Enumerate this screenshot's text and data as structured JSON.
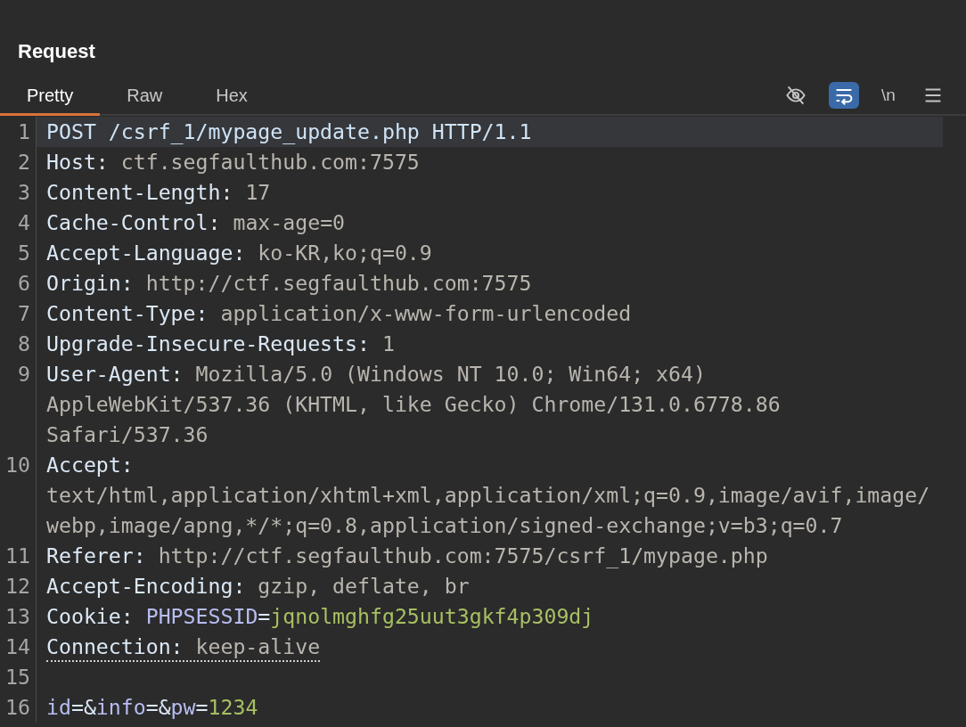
{
  "panel": {
    "title": "Request"
  },
  "tabs": [
    {
      "label": "Pretty",
      "selected": true
    },
    {
      "label": "Raw",
      "selected": false
    },
    {
      "label": "Hex",
      "selected": false
    }
  ],
  "toolbar": [
    {
      "kind": "eye_off",
      "selected": false
    },
    {
      "kind": "wrap",
      "selected": true
    },
    {
      "kind": "text",
      "label": "\\n",
      "selected": false
    },
    {
      "kind": "menu",
      "selected": false
    }
  ],
  "lines": [
    {
      "number": "1",
      "highlighted": true,
      "underlined": false,
      "segments": [
        {
          "kind": "request",
          "text": "POST /csrf_1/mypage_update.php HTTP/1.1"
        }
      ]
    },
    {
      "number": "2",
      "highlighted": false,
      "underlined": false,
      "segments": [
        {
          "kind": "header_name",
          "text": "Host:"
        },
        {
          "kind": "header_value",
          "text": "ctf.segfaulthub.com:7575"
        }
      ]
    },
    {
      "number": "3",
      "highlighted": false,
      "underlined": false,
      "segments": [
        {
          "kind": "header_name",
          "text": "Content-Length:"
        },
        {
          "kind": "header_value",
          "text": "17"
        }
      ]
    },
    {
      "number": "4",
      "highlighted": false,
      "underlined": false,
      "segments": [
        {
          "kind": "header_name",
          "text": "Cache-Control:"
        },
        {
          "kind": "header_value",
          "text": "max-age=0"
        }
      ]
    },
    {
      "number": "5",
      "highlighted": false,
      "underlined": false,
      "segments": [
        {
          "kind": "header_name",
          "text": "Accept-Language:"
        },
        {
          "kind": "header_value",
          "text": "ko-KR,ko;q=0.9"
        }
      ]
    },
    {
      "number": "6",
      "highlighted": false,
      "underlined": false,
      "segments": [
        {
          "kind": "header_name",
          "text": "Origin:"
        },
        {
          "kind": "header_value",
          "text": "http://ctf.segfaulthub.com:7575"
        }
      ]
    },
    {
      "number": "7",
      "highlighted": false,
      "underlined": false,
      "segments": [
        {
          "kind": "header_name",
          "text": "Content-Type:"
        },
        {
          "kind": "header_value",
          "text": "application/x-www-form-urlencoded"
        }
      ]
    },
    {
      "number": "8",
      "highlighted": false,
      "underlined": false,
      "segments": [
        {
          "kind": "header_name",
          "text": "Upgrade-Insecure-Requests:"
        },
        {
          "kind": "header_value",
          "text": "1"
        }
      ]
    },
    {
      "number": "9",
      "highlighted": false,
      "underlined": false,
      "segments": [
        {
          "kind": "header_name",
          "text": "User-Agent:"
        },
        {
          "kind": "header_value",
          "text": "Mozilla/5.0 (Windows NT 10.0; Win64; x64) AppleWebKit/537.36 (KHTML, like Gecko) Chrome/131.0.6778.86 Safari/537.36"
        }
      ]
    },
    {
      "number": "10",
      "highlighted": false,
      "underlined": false,
      "segments": [
        {
          "kind": "header_name",
          "text": "Accept:"
        },
        {
          "kind": "header_value",
          "text": "text/html,application/xhtml+xml,application/xml;q=0.9,image/avif,image/webp,image/apng,*/*;q=0.8,application/signed-exchange;v=b3;q=0.7"
        }
      ]
    },
    {
      "number": "11",
      "highlighted": false,
      "underlined": false,
      "segments": [
        {
          "kind": "header_name",
          "text": "Referer:"
        },
        {
          "kind": "header_value",
          "text": "http://ctf.segfaulthub.com:7575/csrf_1/mypage.php"
        }
      ]
    },
    {
      "number": "12",
      "highlighted": false,
      "underlined": false,
      "segments": [
        {
          "kind": "header_name",
          "text": "Accept-Encoding:"
        },
        {
          "kind": "header_value",
          "text": "gzip, deflate, br"
        }
      ]
    },
    {
      "number": "13",
      "highlighted": false,
      "underlined": false,
      "segments": [
        {
          "kind": "header_name",
          "text": "Cookie:"
        },
        {
          "kind": "param_name",
          "text": "PHPSESSID"
        },
        {
          "kind": "punct",
          "text": "="
        },
        {
          "kind": "param_value",
          "text": "jqnolmghfg25uut3gkf4p309dj"
        }
      ]
    },
    {
      "number": "14",
      "highlighted": false,
      "underlined": true,
      "segments": [
        {
          "kind": "header_name",
          "text": "Connection:"
        },
        {
          "kind": "header_value",
          "text": "keep-alive"
        }
      ]
    },
    {
      "number": "15"
    },
    {
      "number": "16",
      "highlighted": false,
      "underlined": false,
      "segments": [
        {
          "kind": "param_name",
          "text": "id"
        },
        {
          "kind": "punct",
          "text": "=&"
        },
        {
          "kind": "param_name",
          "text": "info"
        },
        {
          "kind": "punct",
          "text": "=&"
        },
        {
          "kind": "param_name",
          "text": "pw"
        },
        {
          "kind": "punct",
          "text": "="
        },
        {
          "kind": "param_value",
          "text": "1234"
        }
      ]
    }
  ]
}
